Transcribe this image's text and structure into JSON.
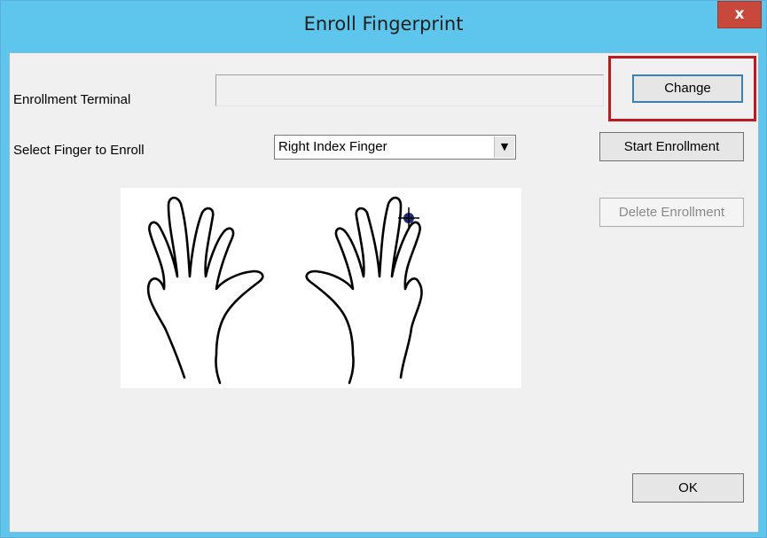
{
  "window": {
    "title": "Enroll Fingerprint",
    "close_label": "x"
  },
  "form": {
    "terminal_label": "Enrollment Terminal",
    "terminal_value": "",
    "finger_label": "Select Finger to Enroll",
    "finger_selected": "Right Index Finger"
  },
  "buttons": {
    "change": "Change",
    "start": "Start Enrollment",
    "delete": "Delete Enrollment",
    "ok": "OK"
  },
  "icons": {
    "dropdown": "chevron-down-icon",
    "marker": "crosshair-marker-icon"
  },
  "colors": {
    "titlebar": "#5ec6ec",
    "highlight": "#c0181f",
    "close": "#c9483c"
  }
}
